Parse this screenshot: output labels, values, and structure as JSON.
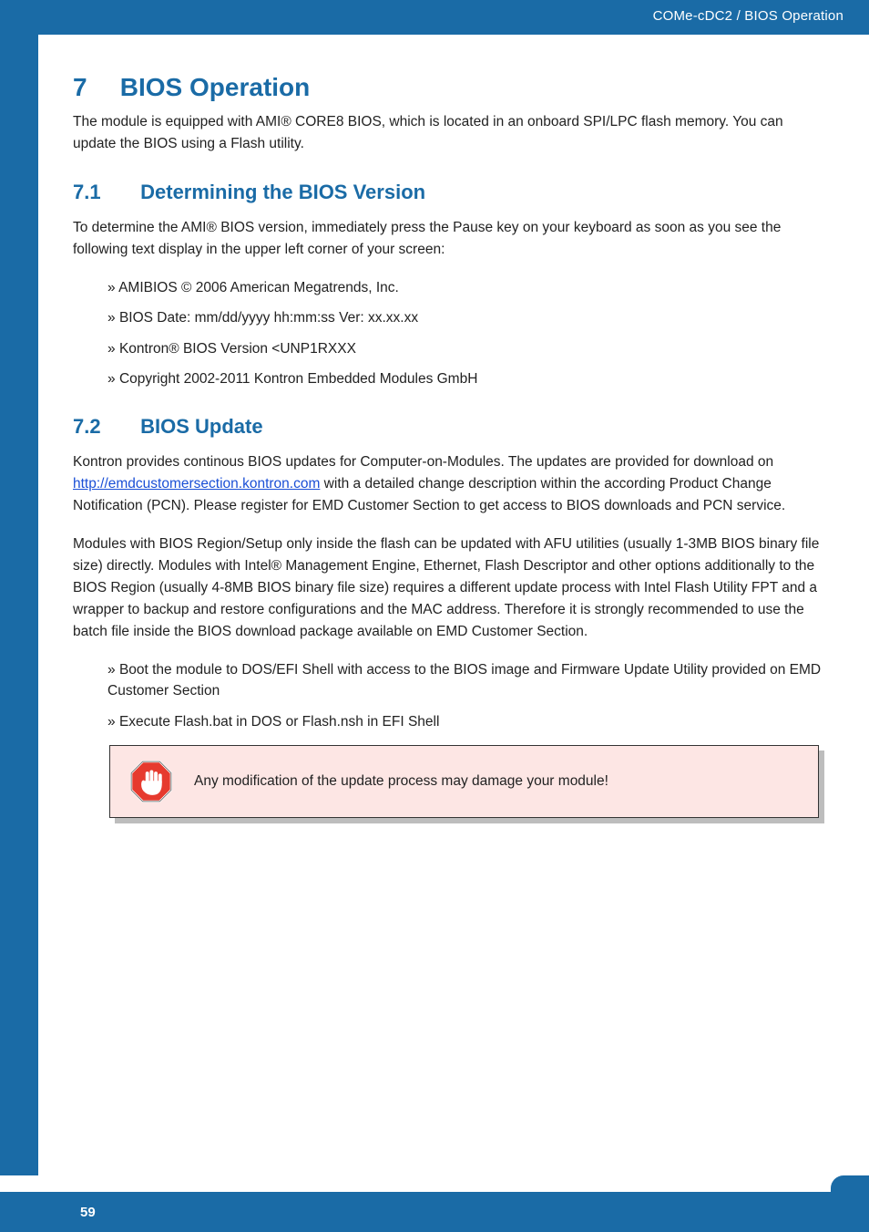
{
  "header": {
    "breadcrumb": "COMe-cDC2 / BIOS Operation"
  },
  "section7": {
    "num": "7",
    "title": "BIOS Operation",
    "intro": "The module is equipped with AMI® CORE8 BIOS, which is located in an onboard SPI/LPC flash memory. You can update the BIOS using a Flash utility."
  },
  "section71": {
    "num": "7.1",
    "title": "Determining the BIOS Version",
    "intro": "To determine the AMI® BIOS version, immediately press the Pause key on your keyboard as soon as you see the following text display in the upper left corner of your screen:",
    "bullets": [
      "AMIBIOS © 2006 American Megatrends, Inc.",
      "BIOS Date: mm/dd/yyyy hh:mm:ss Ver: xx.xx.xx",
      "Kontron® BIOS Version <UNP1RXXX",
      "Copyright 2002-2011 Kontron Embedded Modules GmbH"
    ]
  },
  "section72": {
    "num": "7.2",
    "title": "BIOS Update",
    "para1_pre": "Kontron provides continous BIOS updates for Computer-on-Modules. The updates are provided for download on ",
    "para1_link": "http://emdcustomersection.kontron.com",
    "para1_post": " with a detailed change description within the according Product Change Notification (PCN). Please register for EMD Customer Section to get access to BIOS downloads and PCN service.",
    "para2": "Modules with BIOS Region/Setup only inside the flash can be updated with AFU utilities (usually 1-3MB BIOS binary file size) directly. Modules with Intel® Management Engine, Ethernet, Flash Descriptor and other options additionally to the BIOS Region (usually 4-8MB BIOS binary file size) requires a different update process with Intel Flash Utility FPT and a wrapper to backup and restore configurations and the MAC address. Therefore it is strongly recommended to use the batch file inside the BIOS download package available on EMD Customer Section.",
    "bullets": [
      "Boot the module to DOS/EFI Shell with access to the BIOS image and Firmware Update Utility provided on EMD Customer Section",
      "Execute Flash.bat in DOS or Flash.nsh in EFI Shell"
    ],
    "warning": "Any modification of the update process may damage your module!"
  },
  "footer": {
    "page": "59"
  }
}
